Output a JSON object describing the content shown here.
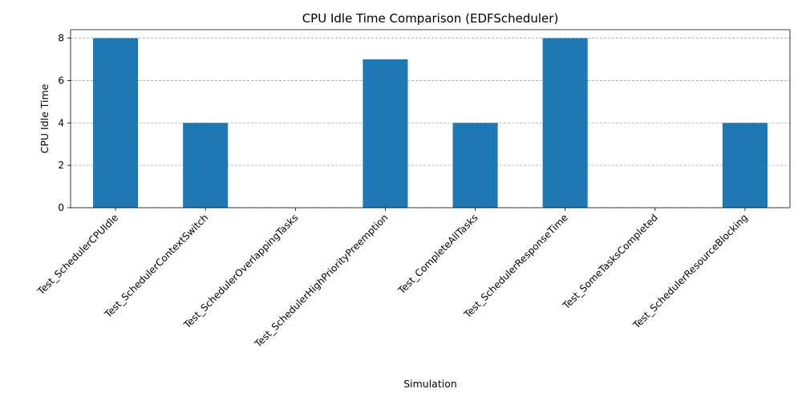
{
  "chart_data": {
    "type": "bar",
    "title": "CPU Idle Time Comparison (EDFScheduler)",
    "xlabel": "Simulation",
    "ylabel": "CPU Idle Time",
    "categories": [
      "Test_SchedulerCPUIdle",
      "Test_SchedulerContextSwitch",
      "Test_SchedulerOverlappingTasks",
      "Test_SchedulerHighPriorityPreemption",
      "Test_CompleteAllTasks",
      "Test_SchedulerResponseTime",
      "Test_SomeTasksCompleted",
      "Test_SchedulerResourceBlocking"
    ],
    "values": [
      8,
      4,
      0,
      7,
      4,
      8,
      0,
      4
    ],
    "ylim": [
      0,
      8.4
    ],
    "yticks": [
      0,
      2,
      4,
      6,
      8
    ],
    "grid": "y-dashed",
    "legend": "none",
    "colors": {
      "bar": "#1f77b4",
      "grid": "#a6a6a6",
      "axis": "#000000"
    }
  }
}
